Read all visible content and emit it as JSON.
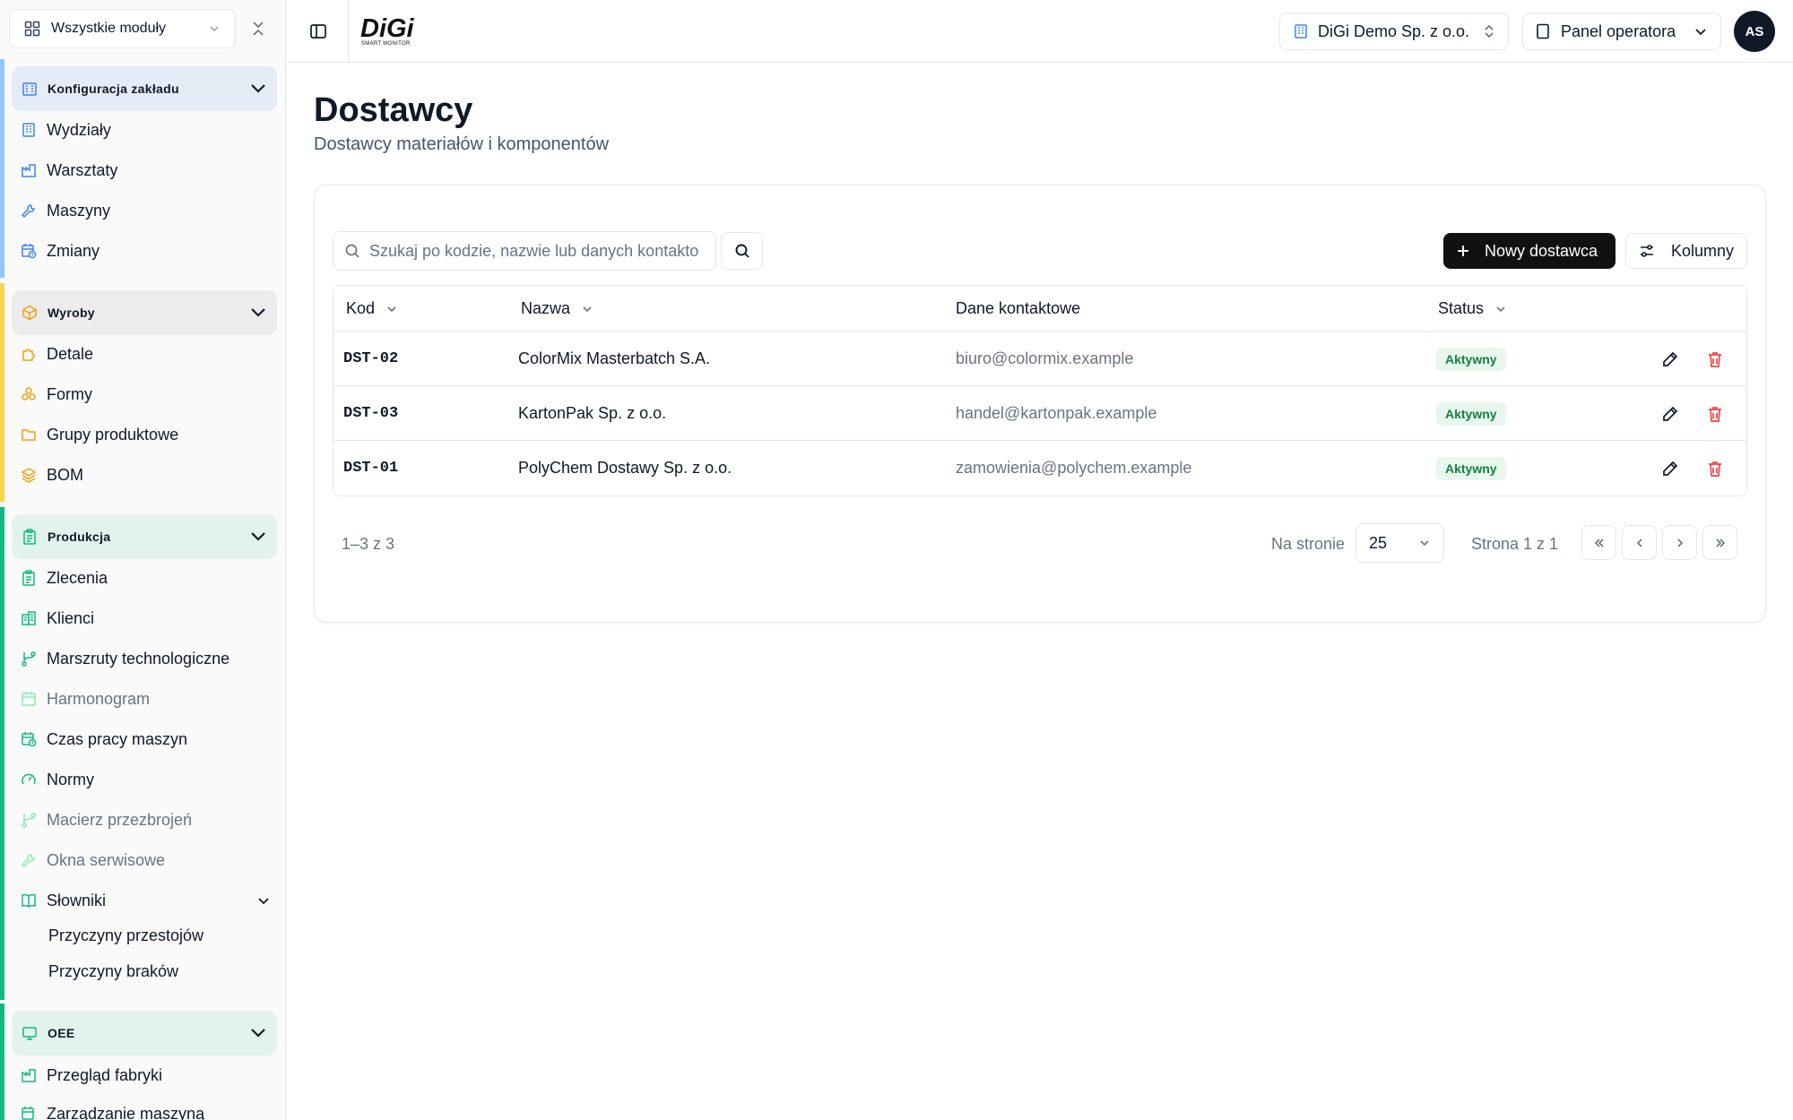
{
  "sidebar": {
    "module_select": "Wszystkie moduły",
    "sections": [
      {
        "title": "Konfiguracja zakładu",
        "items": [
          "Wydziały",
          "Warsztaty",
          "Maszyny",
          "Zmiany"
        ]
      },
      {
        "title": "Wyroby",
        "items": [
          "Detale",
          "Formy",
          "Grupy produktowe",
          "BOM"
        ]
      },
      {
        "title": "Produkcja",
        "items": [
          "Zlecenia",
          "Klienci",
          "Marszruty technologiczne",
          "Harmonogram",
          "Czas pracy maszyn",
          "Normy",
          "Macierz przezbrojeń",
          "Okna serwisowe",
          "Słowniki"
        ],
        "subitems": [
          "Przyczyny przestojów",
          "Przyczyny braków"
        ]
      },
      {
        "title": "OEE",
        "items": [
          "Przegląd fabryki",
          "Zarządzanie maszyną"
        ]
      }
    ]
  },
  "topbar": {
    "logo_text": "DiGi",
    "logo_sub": "SMART MONITOR",
    "company": "DiGi Demo Sp. z o.o.",
    "panel": "Panel operatora",
    "avatar": "AS"
  },
  "page": {
    "title": "Dostawcy",
    "subtitle": "Dostawcy materiałów i komponentów"
  },
  "toolbar": {
    "search_placeholder": "Szukaj po kodzie, nazwie lub danych kontakto",
    "new_label": "Nowy dostawca",
    "columns_label": "Kolumny"
  },
  "table": {
    "headers": {
      "code": "Kod",
      "name": "Nazwa",
      "contact": "Dane kontaktowe",
      "status": "Status"
    },
    "rows": [
      {
        "code": "DST-02",
        "name": "ColorMix Masterbatch S.A.",
        "contact": "biuro@colormix.example",
        "status": "Aktywny"
      },
      {
        "code": "DST-03",
        "name": "KartonPak Sp. z o.o.",
        "contact": "handel@kartonpak.example",
        "status": "Aktywny"
      },
      {
        "code": "DST-01",
        "name": "PolyChem Dostawy Sp. z o.o.",
        "contact": "zamowienia@polychem.example",
        "status": "Aktywny"
      }
    ]
  },
  "pagination": {
    "range": "1–3 z 3",
    "per_page_label": "Na stronie",
    "per_page": "25",
    "page_info": "Strona 1 z 1"
  },
  "colors": {
    "config_accent": "#3b82f6",
    "products_accent": "#f59e0b",
    "production_accent": "#10b981",
    "danger": "#ef4444"
  }
}
